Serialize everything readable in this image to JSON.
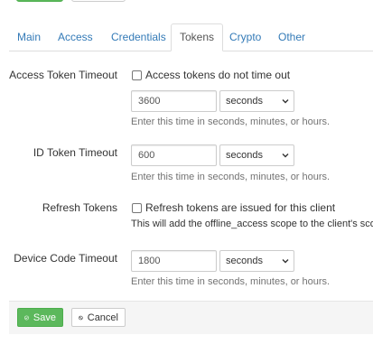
{
  "tabs": [
    {
      "label": "Main",
      "active": false
    },
    {
      "label": "Access",
      "active": false
    },
    {
      "label": "Credentials",
      "active": false
    },
    {
      "label": "Tokens",
      "active": true
    },
    {
      "label": "Crypto",
      "active": false
    },
    {
      "label": "Other",
      "active": false
    }
  ],
  "access_token_timeout": {
    "label": "Access Token Timeout",
    "checkbox_label": "Access tokens do not time out",
    "checked": false,
    "value": "3600",
    "unit": "seconds",
    "help": "Enter this time in seconds, minutes, or hours."
  },
  "id_token_timeout": {
    "label": "ID Token Timeout",
    "value": "600",
    "unit": "seconds",
    "help": "Enter this time in seconds, minutes, or hours."
  },
  "refresh_tokens": {
    "label": "Refresh Tokens",
    "checkbox_label": "Refresh tokens are issued for this client",
    "checked": false,
    "help": "This will add the offline_access scope to the client's sco"
  },
  "device_code_timeout": {
    "label": "Device Code Timeout",
    "value": "1800",
    "unit": "seconds",
    "help": "Enter this time in seconds, minutes, or hours."
  },
  "footer": {
    "save_label": "Save",
    "cancel_label": "Cancel"
  },
  "colors": {
    "link": "#337ab7",
    "save_button": "#5cb85c",
    "help_text": "#737373"
  },
  "icons": [
    "chevron-down-icon",
    "check-circle-icon",
    "ban-icon"
  ]
}
